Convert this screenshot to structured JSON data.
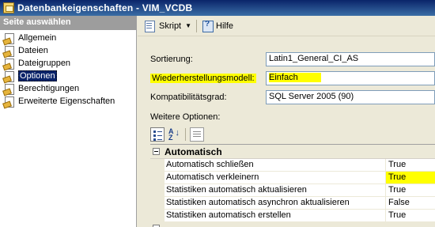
{
  "window": {
    "title": "Datenbankeigenschaften - VIM_VCDB"
  },
  "sidebar": {
    "header": "Seite auswählen",
    "items": [
      {
        "label": "Allgemein",
        "selected": false
      },
      {
        "label": "Dateien",
        "selected": false
      },
      {
        "label": "Dateigruppen",
        "selected": false
      },
      {
        "label": "Optionen",
        "selected": true
      },
      {
        "label": "Berechtigungen",
        "selected": false
      },
      {
        "label": "Erweiterte Eigenschaften",
        "selected": false
      }
    ]
  },
  "toolbar": {
    "script_label": "Skript",
    "help_label": "Hilfe"
  },
  "form": {
    "sortierung": {
      "label": "Sortierung:",
      "value": "Latin1_General_CI_AS"
    },
    "wiederherstellung": {
      "label": "Wiederherstellungsmodell:",
      "value": "Einfach"
    },
    "kompat": {
      "label": "Kompatibilitätsgrad:",
      "value": "SQL Server 2005 (90)"
    },
    "weitere_label": "Weitere Optionen:"
  },
  "grid": {
    "category": "Automatisch",
    "rows": [
      {
        "name": "Automatisch schließen",
        "value": "True",
        "highlight": false
      },
      {
        "name": "Automatisch verkleinern",
        "value": "True",
        "highlight": true
      },
      {
        "name": "Statistiken automatisch aktualisieren",
        "value": "True",
        "highlight": false
      },
      {
        "name": "Statistiken automatisch asynchron aktualisieren",
        "value": "False",
        "highlight": false
      },
      {
        "name": "Statistiken automatisch erstellen",
        "value": "True",
        "highlight": false
      }
    ]
  },
  "colors": {
    "highlight": "#ffff00",
    "title_start": "#0a246a",
    "title_end": "#3a6ea5",
    "selection": "#0a246a"
  },
  "icons": {
    "title": "database-properties-icon",
    "page": "page-icon",
    "script": "script-icon",
    "help": "help-icon"
  }
}
